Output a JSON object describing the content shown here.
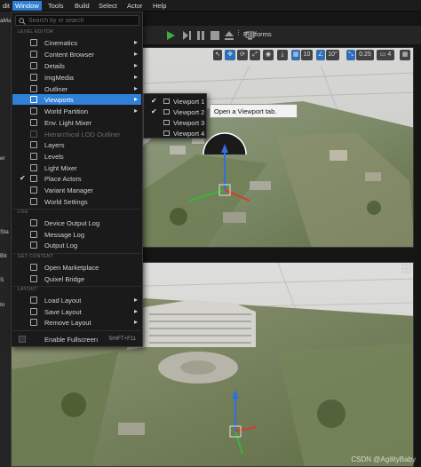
{
  "menubar": {
    "items": [
      "dit",
      "Window",
      "Tools",
      "Build",
      "Select",
      "Actor",
      "Help"
    ]
  },
  "left_strip": [
    "aMa",
    "er",
    "Sta",
    "Bit",
    "S",
    "In"
  ],
  "toolbar": {
    "platforms_label": "Platforms"
  },
  "viewport_toolbar": {
    "grid_value": "10",
    "angle_value": "10°",
    "scale_value": "0.25",
    "camera_speed": "4"
  },
  "window_menu": {
    "search_placeholder": "Search by or search",
    "sections": {
      "level_editor": "LEVEL EDITOR",
      "log": "LOG",
      "get_content": "GET CONTENT",
      "layout": "LAYOUT"
    },
    "level_editor_items": [
      {
        "label": "Cinematics",
        "submenu": true
      },
      {
        "label": "Content Browser",
        "submenu": true
      },
      {
        "label": "Details",
        "submenu": true
      },
      {
        "label": "ImgMedia",
        "submenu": true
      },
      {
        "label": "Outliner",
        "submenu": true
      },
      {
        "label": "Viewports",
        "submenu": true,
        "highlighted": true
      },
      {
        "label": "World Partition",
        "submenu": true
      },
      {
        "label": "Env. Light Mixer"
      },
      {
        "label": "Hierarchical LOD Outliner",
        "disabled": true
      },
      {
        "label": "Layers"
      },
      {
        "label": "Levels"
      },
      {
        "label": "Light Mixer"
      },
      {
        "label": "Place Actors",
        "checked": true
      },
      {
        "label": "Variant Manager"
      },
      {
        "label": "World Settings"
      }
    ],
    "log_items": [
      {
        "label": "Device Output Log"
      },
      {
        "label": "Message Log"
      },
      {
        "label": "Output Log"
      }
    ],
    "get_content_items": [
      {
        "label": "Open Marketplace"
      },
      {
        "label": "Quixel Bridge"
      }
    ],
    "layout_items": [
      {
        "label": "Load Layout",
        "submenu": true
      },
      {
        "label": "Save Layout",
        "submenu": true
      },
      {
        "label": "Remove Layout",
        "submenu": true
      }
    ],
    "fullscreen": {
      "label": "Enable Fullscreen",
      "shortcut": "SHIFT+F11"
    }
  },
  "viewports_submenu": [
    {
      "label": "Viewport 1",
      "checked": true
    },
    {
      "label": "Viewport 2",
      "checked": true
    },
    {
      "label": "Viewport 3"
    },
    {
      "label": "Viewport 4"
    }
  ],
  "tooltip": "Open a Viewport tab.",
  "watermark": "CSDN @AgilityBaby",
  "colors": {
    "accent": "#2f80d6",
    "menu_bg": "#1a1a1a",
    "play_green": "#3fae3f"
  }
}
